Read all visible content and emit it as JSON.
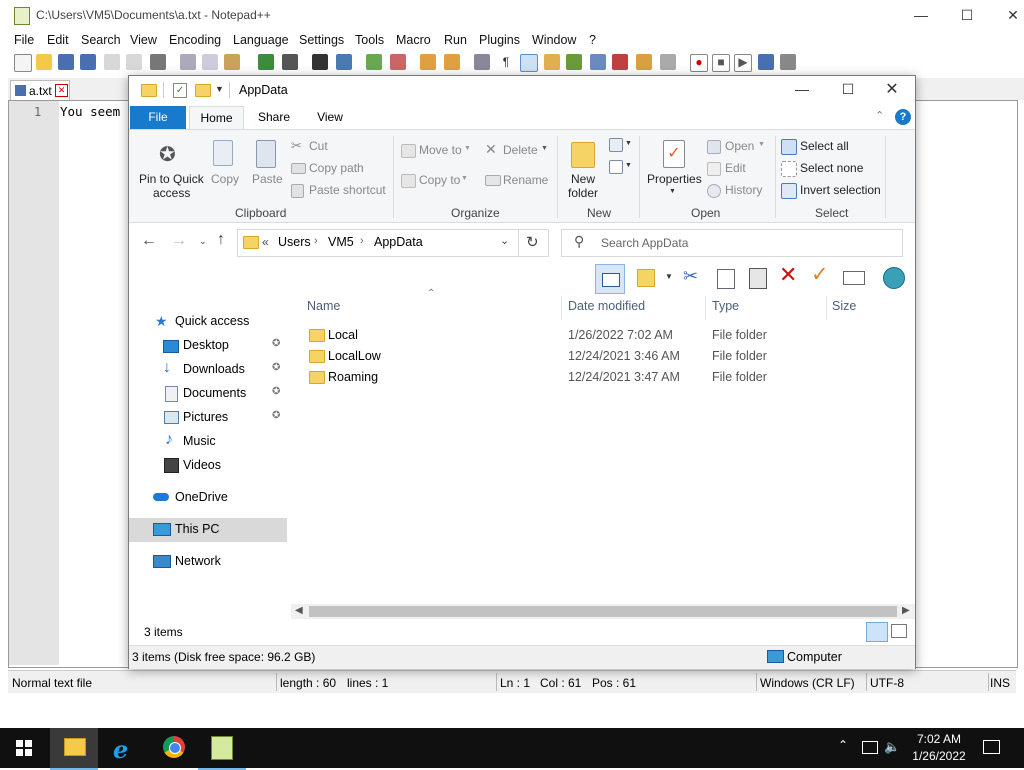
{
  "npp": {
    "title": "C:\\Users\\VM5\\Documents\\a.txt - Notepad++",
    "menu": [
      "File",
      "Edit",
      "Search",
      "View",
      "Encoding",
      "Language",
      "Settings",
      "Tools",
      "Macro",
      "Run",
      "Plugins",
      "Window",
      "?"
    ],
    "tab_label": "a.txt",
    "line_number": "1",
    "editor_text": "You seem",
    "status": {
      "mode": "Normal text file",
      "length": "length : 60",
      "lines": "lines : 1",
      "ln": "Ln : 1",
      "col": "Col : 61",
      "pos": "Pos : 61",
      "eol": "Windows (CR LF)",
      "encoding": "UTF-8",
      "ins": "INS"
    }
  },
  "explorer": {
    "title": "AppData",
    "ribbon_tabs": [
      "File",
      "Home",
      "Share",
      "View"
    ],
    "clipboard": {
      "pin": "Pin to Quick",
      "pin2": "access",
      "copy": "Copy",
      "paste": "Paste",
      "cut": "Cut",
      "copy_path": "Copy path",
      "paste_shortcut": "Paste shortcut",
      "group": "Clipboard"
    },
    "organize": {
      "move_to": "Move to",
      "copy_to": "Copy to",
      "delete": "Delete",
      "rename": "Rename",
      "group": "Organize"
    },
    "new": {
      "new_folder": "New",
      "new_folder2": "folder",
      "group": "New"
    },
    "open": {
      "properties": "Properties",
      "open": "Open",
      "edit": "Edit",
      "history": "History",
      "group": "Open"
    },
    "select": {
      "select_all": "Select all",
      "select_none": "Select none",
      "invert": "Invert selection",
      "group": "Select"
    },
    "breadcrumb": {
      "prefix": "«",
      "items": [
        "Users",
        "VM5",
        "AppData"
      ]
    },
    "search_placeholder": "Search AppData",
    "columns": {
      "name": "Name",
      "date": "Date modified",
      "type": "Type",
      "size": "Size"
    },
    "files": [
      {
        "name": "Local",
        "date": "1/26/2022 7:02 AM",
        "type": "File folder"
      },
      {
        "name": "LocalLow",
        "date": "12/24/2021 3:46 AM",
        "type": "File folder"
      },
      {
        "name": "Roaming",
        "date": "12/24/2021 3:47 AM",
        "type": "File folder"
      }
    ],
    "nav": {
      "quick_access": "Quick access",
      "desktop": "Desktop",
      "downloads": "Downloads",
      "documents": "Documents",
      "pictures": "Pictures",
      "music": "Music",
      "videos": "Videos",
      "onedrive": "OneDrive",
      "this_pc": "This PC",
      "network": "Network"
    },
    "item_count": "3 items",
    "details_status": "3 items (Disk free space: 96.2 GB)",
    "computer_label": "Computer"
  },
  "taskbar": {
    "time": "7:02 AM",
    "date": "1/26/2022"
  },
  "colors": {
    "accent": "#1979ca",
    "folder": "#f6d365",
    "taskbar": "#101010"
  }
}
